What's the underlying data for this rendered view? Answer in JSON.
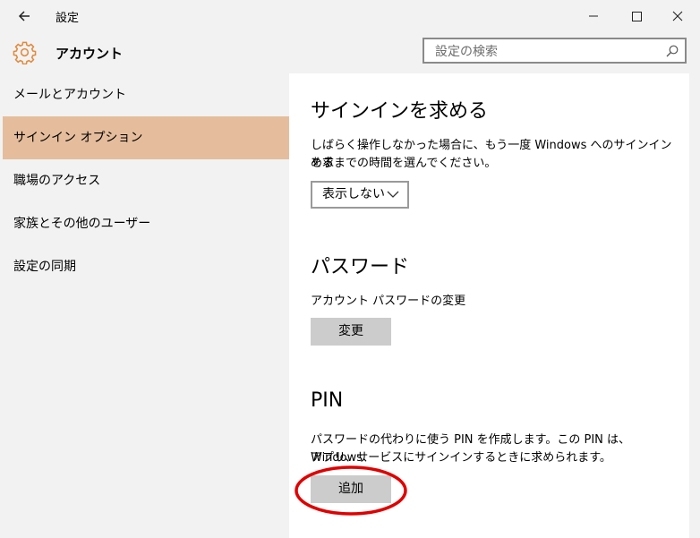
{
  "window": {
    "title": "設定"
  },
  "header": {
    "page_title": "アカウント"
  },
  "search": {
    "placeholder": "設定の検索"
  },
  "sidebar": {
    "items": [
      {
        "label": "メールとアカウント",
        "active": false
      },
      {
        "label": "サインイン オプション",
        "active": true
      },
      {
        "label": "職場のアクセス",
        "active": false
      },
      {
        "label": "家族とその他のユーザー",
        "active": false
      },
      {
        "label": "設定の同期",
        "active": false
      }
    ]
  },
  "content": {
    "signin_required": {
      "title": "サインインを求める",
      "description_line1": "しばらく操作しなかった場合に、もう一度 Windows へのサインインを求",
      "description_line2": "めるまでの時間を選んでください。",
      "dropdown_value": "表示しない"
    },
    "password": {
      "title": "パスワード",
      "description": "アカウント パスワードの変更",
      "button_label": "変更"
    },
    "pin": {
      "title": "PIN",
      "description_line1": "パスワードの代わりに使う PIN を作成します。この PIN は、Windows、",
      "description_line2": "アプリ、サービスにサインインするときに求められます。",
      "button_label": "追加"
    }
  },
  "icons": {
    "back": "back-arrow-icon",
    "gear": "gear-icon",
    "search": "search-icon",
    "minimize": "minimize-icon",
    "maximize": "maximize-icon",
    "close": "close-icon",
    "chevron": "chevron-down-icon"
  },
  "colors": {
    "accent_selection": "#e5bd9c",
    "gear_orange": "#e08a3c",
    "highlight_circle": "#e00000",
    "button_gray": "#cccccc"
  }
}
